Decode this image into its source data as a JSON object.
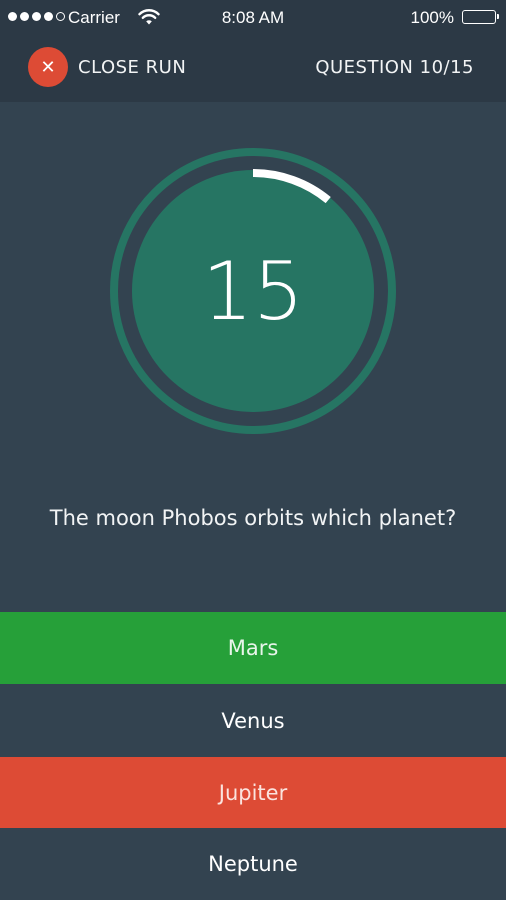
{
  "status_bar": {
    "carrier": "Carrier",
    "time": "8:08 AM",
    "battery": "100%",
    "signal_bars_filled": 4,
    "signal_bars_total": 5
  },
  "header": {
    "close_label": "CLOSE RUN",
    "close_icon": "close-icon",
    "question_counter": "QUESTION 10/15"
  },
  "timer": {
    "value": "15",
    "progress_fraction": 0.11,
    "ring_color": "#267563",
    "progress_color": "#ffffff"
  },
  "question": {
    "text": "The moon Phobos orbits which planet?"
  },
  "answers": [
    {
      "label": "Mars",
      "state": "correct",
      "color": "#26a039"
    },
    {
      "label": "Venus",
      "state": "neutral",
      "color": "#334350"
    },
    {
      "label": "Jupiter",
      "state": "wrong",
      "color": "#dd4b35"
    },
    {
      "label": "Neptune",
      "state": "neutral",
      "color": "#334350"
    }
  ],
  "colors": {
    "background": "#334350",
    "header_background": "#2c3945",
    "close_button": "#dd4b35"
  }
}
